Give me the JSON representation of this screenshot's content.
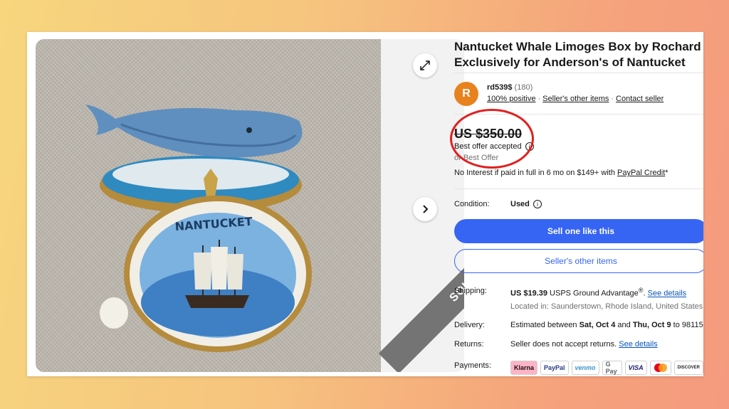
{
  "listing": {
    "title": "Nantucket Whale Limoges Box by Rochard Exclusively for Anderson's of Nantucket",
    "sold_label": "SOLD"
  },
  "seller": {
    "initial": "R",
    "name": "rd539$",
    "feedback_count": "(180)",
    "positive": "100% positive",
    "other_items": "Seller's other items",
    "contact": "Contact seller"
  },
  "price": {
    "amount": "US $350.00",
    "status": "Best offer accepted",
    "or_best_offer": "or Best Offer",
    "financing_text": "No Interest if paid in full in 6 mo on $149+ with ",
    "financing_link": "PayPal Credit",
    "financing_suffix": "*"
  },
  "condition": {
    "label": "Condition:",
    "value": "Used"
  },
  "buttons": {
    "sell_one": "Sell one like this",
    "seller_items": "Seller's other items"
  },
  "shipping": {
    "label": "Shipping:",
    "price": "US $19.39",
    "method": "USPS Ground Advantage",
    "registered": "®",
    "details": "See details",
    "location": "Located in: Saunderstown, Rhode Island, United States"
  },
  "delivery": {
    "label": "Delivery:",
    "prefix": "Estimated between ",
    "start": "Sat, Oct 4",
    "middle": " and ",
    "end": "Thu, Oct 9",
    "suffix": " to 98115"
  },
  "returns": {
    "label": "Returns:",
    "text": "Seller does not accept returns. ",
    "details": "See details"
  },
  "payments": {
    "label": "Payments:",
    "methods": [
      "Klarna",
      "PayPal",
      "venmo",
      "G Pay",
      "VISA",
      "mastercard",
      "DISCOVER"
    ]
  },
  "colors": {
    "accent": "#3665f3",
    "highlight_circle": "#e0201f",
    "avatar": "#e8821e"
  }
}
